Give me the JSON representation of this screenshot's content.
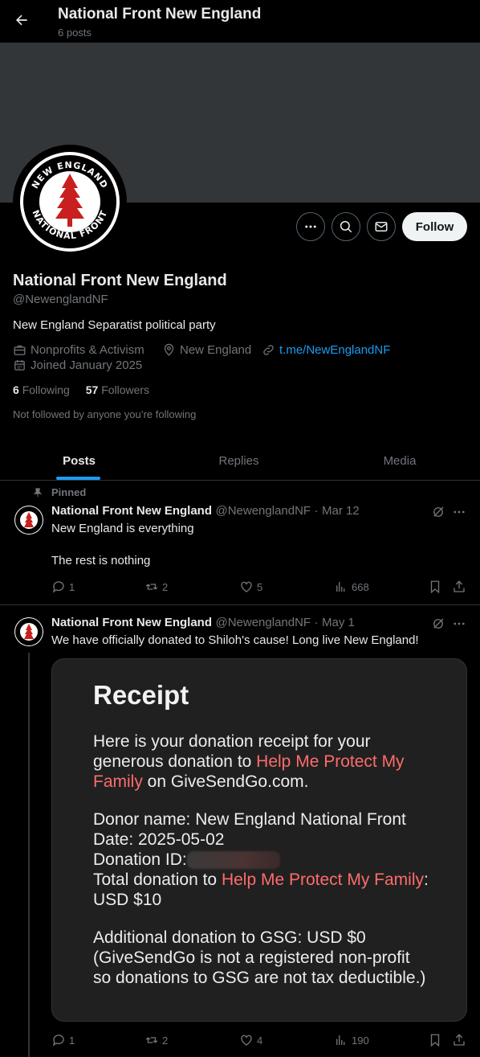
{
  "header": {
    "title": "National Front New England",
    "post_count": "6 posts"
  },
  "profile": {
    "name": "National Front New England",
    "handle": "@NewenglandNF",
    "bio": "New England Separatist political party",
    "category": "Nonprofits & Activism",
    "location": "New England",
    "link": "t.me/NewEnglandNF",
    "joined": "Joined January 2025",
    "following_count": "6",
    "following_label": "Following",
    "followers_count": "57",
    "followers_label": "Followers",
    "not_followed": "Not followed by anyone you’re following",
    "follow_label": "Follow",
    "avatar_text_top": "NEW ENGLAND",
    "avatar_text_bottom": "NATIONAL FRONT"
  },
  "tabs": [
    {
      "label": "Posts",
      "active": true
    },
    {
      "label": "Replies",
      "active": false
    },
    {
      "label": "Media",
      "active": false
    }
  ],
  "tweets": [
    {
      "pinned_label": "Pinned",
      "name": "National Front New England",
      "handle": "@NewenglandNF",
      "date": "Mar 12",
      "line1": "New England is everything",
      "line2": "The rest is nothing",
      "replies": "1",
      "reposts": "2",
      "likes": "5",
      "views": "668"
    },
    {
      "name": "National Front New England",
      "handle": "@NewenglandNF",
      "date": "May 1",
      "text": "We have officially donated to Shiloh's cause! Long live New England!",
      "replies": "1",
      "reposts": "2",
      "likes": "4",
      "views": "190",
      "receipt": {
        "title": "Receipt",
        "intro_a": "Here is your donation receipt for your generous donation to ",
        "intro_link": "Help Me Protect My Family",
        "intro_b": " on GiveSendGo.com.",
        "donor": "Donor name: New England National Front",
        "date": "Date: 2025-05-02",
        "donation_id": "Donation ID:",
        "total_a": "Total donation to ",
        "total_link": "Help Me Protect My Family",
        "total_b": ": USD $10",
        "additional": "Additional donation to GSG: USD $0 (GiveSendGo is not a registered non-profit so donations to GSG are not tax deductible.)"
      }
    }
  ],
  "colors": {
    "accent": "#1d9bf0",
    "muted": "#71767b",
    "receipt_link": "#ff6b6b",
    "banner": "#333639",
    "avatar_tree": "#c8201e"
  }
}
